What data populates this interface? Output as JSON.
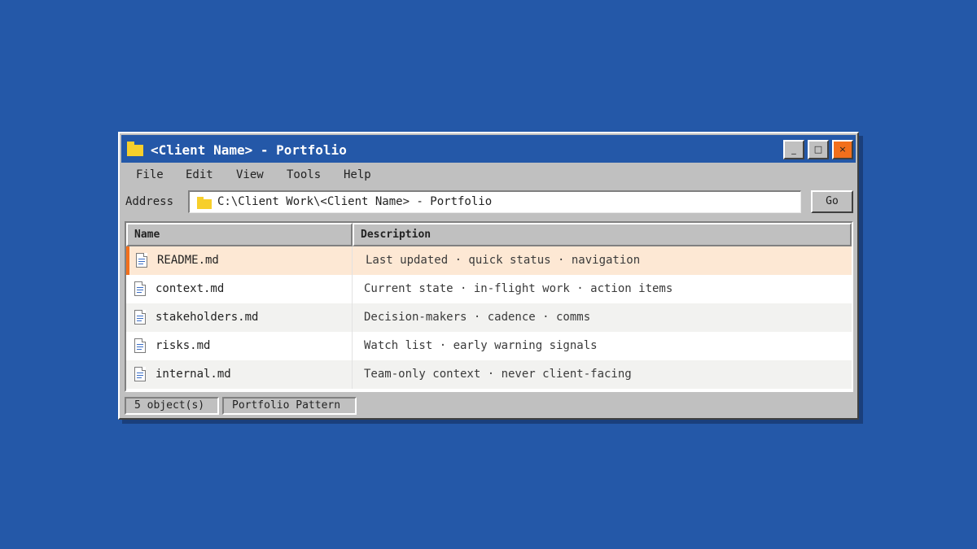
{
  "window": {
    "title": "<Client Name> - Portfolio",
    "controls": {
      "minimize": "_",
      "maximize": "□",
      "close": "×"
    }
  },
  "menu": {
    "items": [
      "File",
      "Edit",
      "View",
      "Tools",
      "Help"
    ]
  },
  "address": {
    "label": "Address",
    "path": "C:\\Client Work\\<Client Name> - Portfolio",
    "go_label": "Go"
  },
  "list": {
    "columns": {
      "name": "Name",
      "description": "Description"
    },
    "files": [
      {
        "name": "README.md",
        "description": "Last updated · quick status · navigation",
        "selected": true
      },
      {
        "name": "context.md",
        "description": "Current state · in-flight work · action items"
      },
      {
        "name": "stakeholders.md",
        "description": "Decision-makers · cadence · comms"
      },
      {
        "name": "risks.md",
        "description": "Watch list · early warning signals"
      },
      {
        "name": "internal.md",
        "description": "Team-only context · never client-facing"
      }
    ]
  },
  "status": {
    "object_count": "5 object(s)",
    "pattern": "Portfolio Pattern"
  },
  "colors": {
    "desktop": "#2458a8",
    "accent": "#f26f1c",
    "selection": "#fde8d4",
    "folder": "#f7cf2b"
  }
}
